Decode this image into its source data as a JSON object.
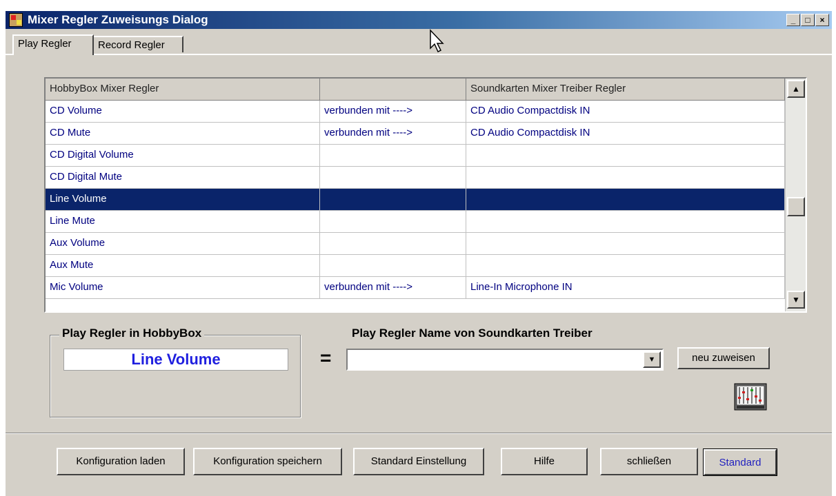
{
  "window": {
    "title": "Mixer Regler  Zuweisungs  Dialog",
    "minimize": "_",
    "maximize": "□",
    "close": "×"
  },
  "tabs": [
    {
      "label": "Play Regler"
    },
    {
      "label": "Record Regler"
    }
  ],
  "grid": {
    "headers": [
      "HobbyBox Mixer Regler",
      "",
      "Soundkarten Mixer Treiber Regler"
    ],
    "rows": [
      {
        "regler": "CD Volume",
        "link": "verbunden mit ---->",
        "treiber": "CD Audio Compactdisk IN"
      },
      {
        "regler": "CD Mute",
        "link": "verbunden mit ---->",
        "treiber": "CD Audio Compactdisk IN"
      },
      {
        "regler": "CD Digital Volume",
        "link": "",
        "treiber": ""
      },
      {
        "regler": "CD Digital Mute",
        "link": "",
        "treiber": ""
      },
      {
        "regler": "Line Volume",
        "link": "",
        "treiber": ""
      },
      {
        "regler": "Line Mute",
        "link": "",
        "treiber": ""
      },
      {
        "regler": "Aux Volume",
        "link": "",
        "treiber": ""
      },
      {
        "regler": "Aux Mute",
        "link": "",
        "treiber": ""
      },
      {
        "regler": "Mic Volume",
        "link": "verbunden mit ---->",
        "treiber": "Line-In Microphone IN"
      }
    ],
    "selected_index": 4,
    "scroll_up": "▲",
    "scroll_down": "▼"
  },
  "hobbybox_group": {
    "label": "Play  Regler in  HobbyBox",
    "value": "Line Volume"
  },
  "equals": "=",
  "soundkarte": {
    "label": "Play Regler Name von Soundkarten Treiber",
    "combo_value": "",
    "combo_arrow": "▼",
    "assign_button": "neu zuweisen"
  },
  "buttons": {
    "load": "Konfiguration laden",
    "save": "Konfiguration speichern",
    "default_settings": "Standard Einstellung",
    "help": "Hilfe",
    "close": "schließen",
    "standard": "Standard"
  },
  "colors": {
    "title_start": "#0a246a",
    "title_end": "#a6caf0",
    "selection": "#0a246a",
    "grid_text": "#000080",
    "group_value": "#1f1fdf",
    "face": "#d4d0c8"
  }
}
